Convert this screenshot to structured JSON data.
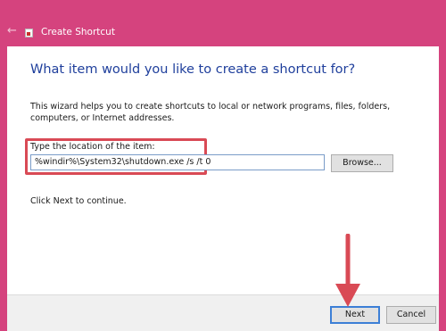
{
  "window": {
    "title": "Create Shortcut",
    "back_icon": "back-arrow-icon",
    "app_icon": "shortcut-icon"
  },
  "main": {
    "heading": "What item would you like to create a shortcut for?",
    "description": "This wizard helps you to create shortcuts to local or network programs, files, folders, computers, or Internet addresses.",
    "location_label": "Type the location of the item:",
    "location_value": "%windir%\\System32\\shutdown.exe /s /t 0",
    "browse_label": "Browse...",
    "continue_text": "Click Next to continue."
  },
  "footer": {
    "next_label": "Next",
    "cancel_label": "Cancel"
  },
  "colors": {
    "window_frame": "#d5437e",
    "heading": "#1f3f9c",
    "annotation": "#d94a55",
    "focus_border": "#3c7fd6"
  }
}
